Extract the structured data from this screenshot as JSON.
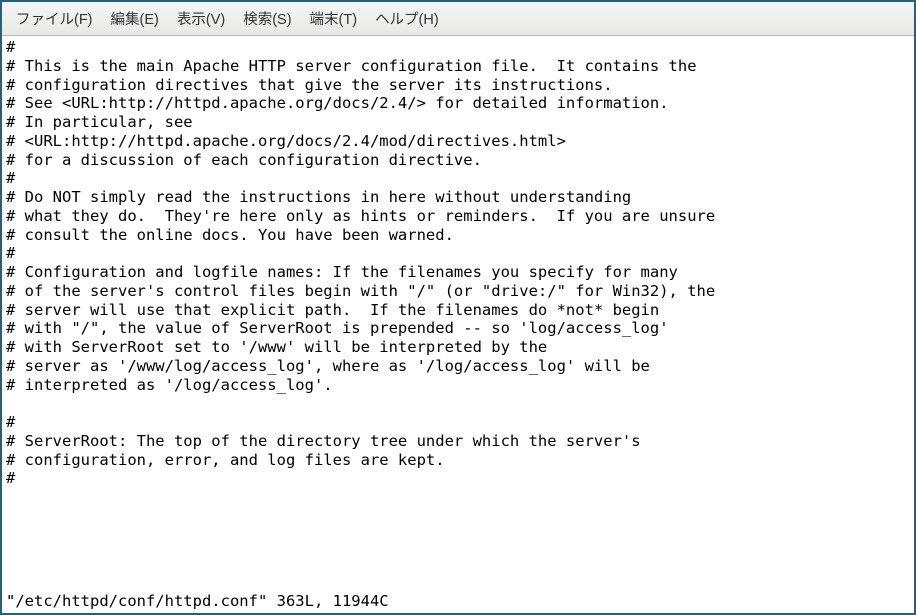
{
  "menu": {
    "file": "ファイル(F)",
    "edit": "編集(E)",
    "view": "表示(V)",
    "search": "検索(S)",
    "terminal": "端末(T)",
    "help": "ヘルプ(H)"
  },
  "file_content": "#\n# This is the main Apache HTTP server configuration file.  It contains the\n# configuration directives that give the server its instructions.\n# See <URL:http://httpd.apache.org/docs/2.4/> for detailed information.\n# In particular, see\n# <URL:http://httpd.apache.org/docs/2.4/mod/directives.html>\n# for a discussion of each configuration directive.\n#\n# Do NOT simply read the instructions in here without understanding\n# what they do.  They're here only as hints or reminders.  If you are unsure\n# consult the online docs. You have been warned.\n#\n# Configuration and logfile names: If the filenames you specify for many\n# of the server's control files begin with \"/\" (or \"drive:/\" for Win32), the\n# server will use that explicit path.  If the filenames do *not* begin\n# with \"/\", the value of ServerRoot is prepended -- so 'log/access_log'\n# with ServerRoot set to '/www' will be interpreted by the\n# server as '/www/log/access_log', where as '/log/access_log' will be\n# interpreted as '/log/access_log'.\n\n#\n# ServerRoot: The top of the directory tree under which the server's\n# configuration, error, and log files are kept.\n#",
  "status_line": "\"/etc/httpd/conf/httpd.conf\" 363L, 11944C"
}
